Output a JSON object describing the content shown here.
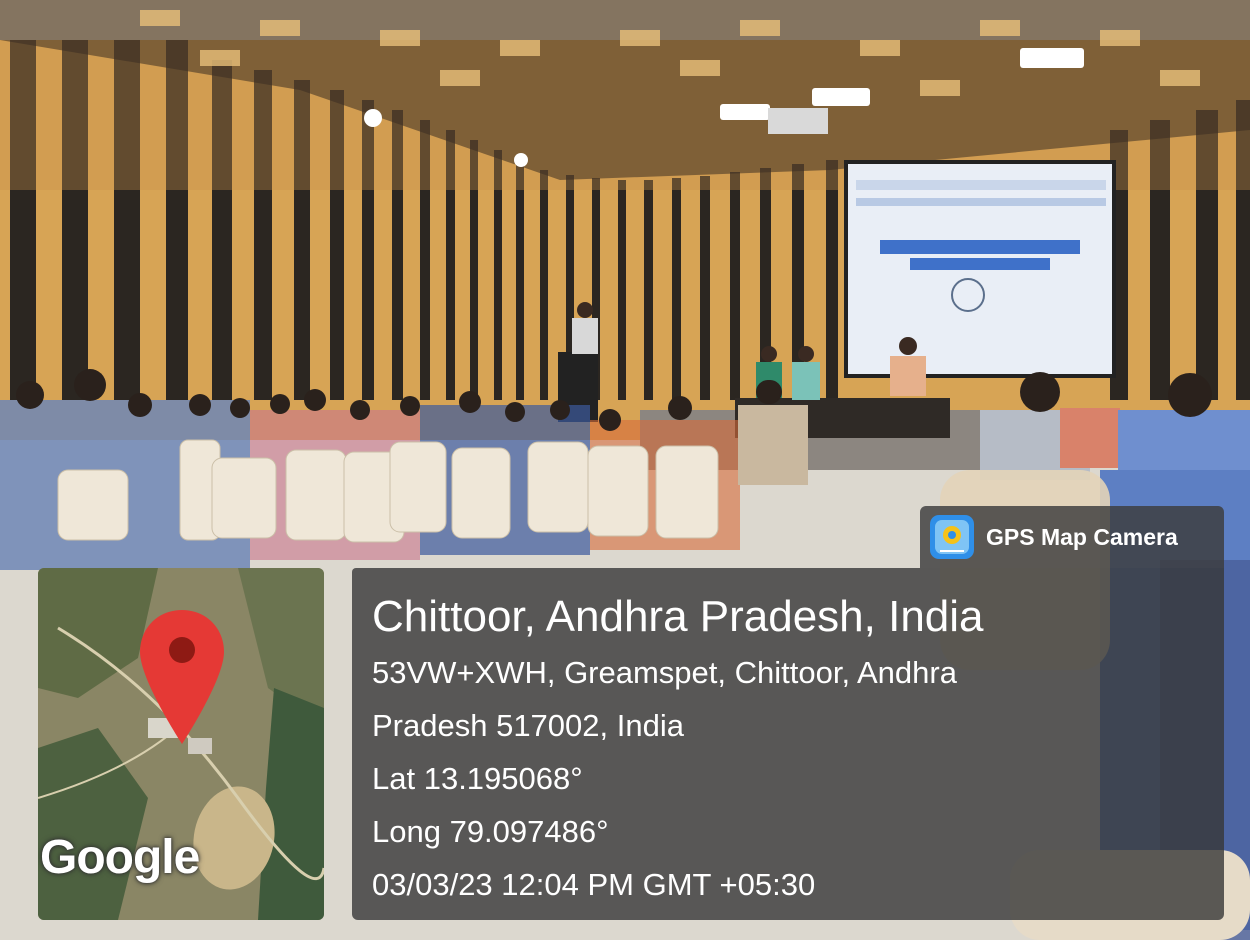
{
  "app": {
    "name": "GPS Map Camera",
    "icon": "gps-camera-icon",
    "accent": "#2f8fe8"
  },
  "overlay": {
    "location_title": "Chittoor, Andhra Pradesh, India",
    "address_line1": "53VW+XWH, Greamspet, Chittoor, Andhra",
    "address_line2": "Pradesh 517002, India",
    "latitude": "Lat 13.195068°",
    "longitude": "Long 79.097486°",
    "datetime": "03/03/23 12:04 PM GMT +05:30"
  },
  "map": {
    "provider_logo": "Google",
    "marker_icon": "map-pin-icon",
    "marker_color": "#e53935"
  },
  "screen": {
    "slide_lines": [
      "INTERNATIONAL WOMEN'S DAY CELEBRATION",
      "CRACKING THE CODE:",
      "INNOVATION FOR A GENDER EQUAL FUTURE"
    ]
  }
}
